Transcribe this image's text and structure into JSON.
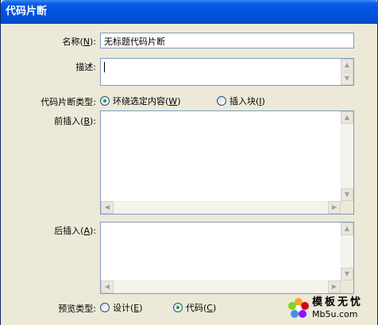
{
  "window": {
    "title": "代码片断"
  },
  "fields": {
    "name": {
      "label": "名称",
      "key": "N",
      "value": "无标题代码片断"
    },
    "description": {
      "label": "描述",
      "value": ""
    },
    "snippet_type": {
      "label": "代码片断类型",
      "options": [
        {
          "label": "环绕选定内容",
          "key": "W",
          "checked": true
        },
        {
          "label": "插入块",
          "key": "I",
          "checked": false
        }
      ]
    },
    "insert_before": {
      "label": "前插入",
      "key": "B",
      "value": ""
    },
    "insert_after": {
      "label": "后插入",
      "key": "A",
      "value": ""
    },
    "preview_type": {
      "label": "预览类型",
      "options": [
        {
          "label": "设计",
          "key": "E",
          "checked": false
        },
        {
          "label": "代码",
          "key": "C",
          "checked": true
        }
      ]
    }
  },
  "watermark": {
    "text": "模板无忧",
    "sub": "Mb5u.com"
  }
}
